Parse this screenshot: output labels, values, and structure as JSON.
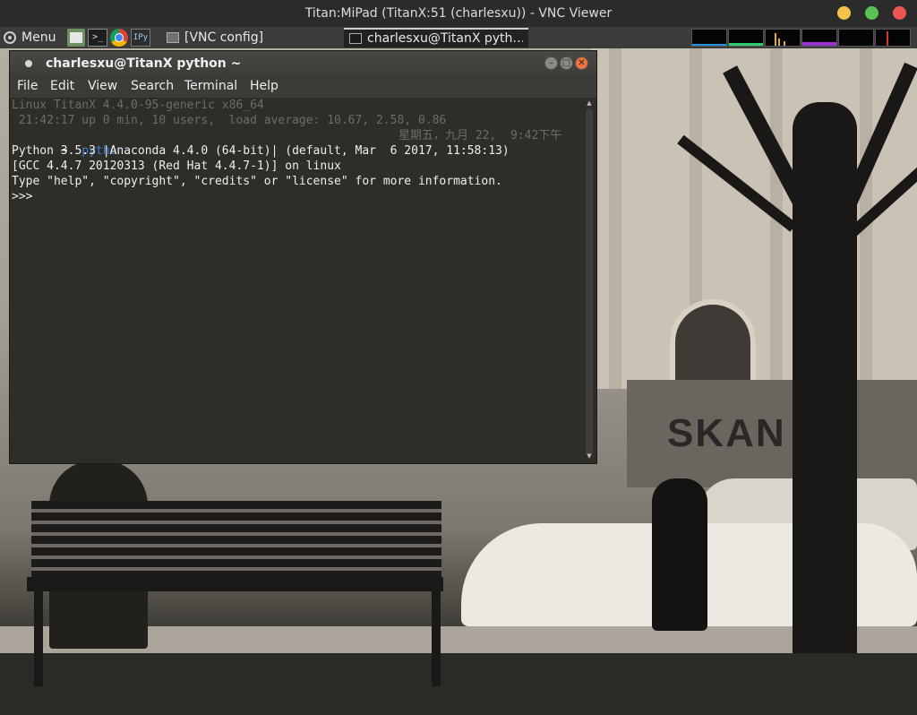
{
  "vnc_viewer": {
    "title": "Titan:MiPad (TitanX:51 (charlesxu)) - VNC Viewer",
    "window_buttons": [
      {
        "name": "minimize",
        "color": "#f4c24a"
      },
      {
        "name": "maximize",
        "color": "#59c255"
      },
      {
        "name": "close",
        "color": "#ee5451"
      }
    ]
  },
  "panel": {
    "menu_label": "Menu",
    "launchers": [
      {
        "icon": "file-manager-icon"
      },
      {
        "icon": "terminal-icon",
        "glyph": ">_"
      },
      {
        "icon": "chrome-icon"
      },
      {
        "icon": "ipython-icon",
        "glyph": "IPy"
      }
    ],
    "tasks": [
      {
        "label": "[VNC config]",
        "active": false
      },
      {
        "label": "charlesxu@TitanX pyth…",
        "active": true
      }
    ],
    "system_monitor_colors": [
      "#1f8fe0",
      "#2ecc71",
      "#e0b020",
      "#9b2fd6",
      "#d03a2f"
    ]
  },
  "wallpaper": {
    "banner_text": "SKAN    KA"
  },
  "terminal": {
    "title": "charlesxu@TitanX python ~",
    "menu": [
      "File",
      "Edit",
      "View",
      "Search",
      "Terminal",
      "Help"
    ],
    "output": {
      "system_line": "Linux TitanX 4.4.0-95-generic x86_64",
      "uptime_line": " 21:42:17 up 0 min, 10 users,  load average: 10.67, 2.58, 0.86",
      "prompt_arrow": " ~",
      "prompt_command": "python",
      "prompt_datetime": "星期五，九月 22,  9:42下午",
      "python_version_line": "Python 3.5.3 |Anaconda 4.4.0 (64-bit)| (default, Mar  6 2017, 11:58:13)",
      "gcc_line": "[GCC 4.4.7 20120313 (Red Hat 4.4.7-1)] on linux",
      "help_line": "Type \"help\", \"copyright\", \"credits\" or \"license\" for more information.",
      "repl_prompt": ">>>"
    }
  }
}
